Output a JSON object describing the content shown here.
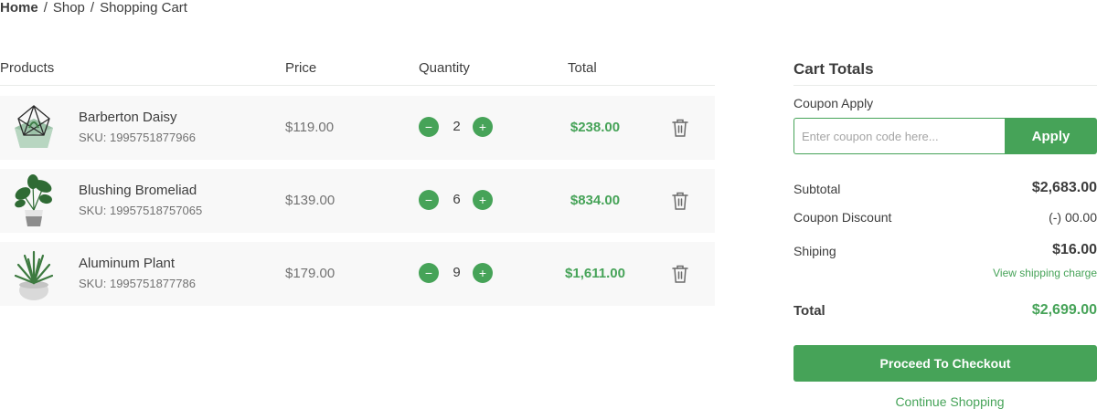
{
  "breadcrumb": {
    "home": "Home",
    "shop": "Shop",
    "current": "Shopping Cart",
    "separator": "/"
  },
  "table": {
    "headers": {
      "products": "Products",
      "price": "Price",
      "quantity": "Quantity",
      "total": "Total"
    },
    "rows": [
      {
        "name": "Barberton Daisy",
        "sku_label": "SKU:",
        "sku": "1995751877966",
        "price": "$119.00",
        "qty": "2",
        "total": "$238.00",
        "image": "geometric-terrarium-plant"
      },
      {
        "name": "Blushing Bromeliad",
        "sku_label": "SKU:",
        "sku": "19957518757065",
        "price": "$139.00",
        "qty": "6",
        "total": "$834.00",
        "image": "potted-leafy-plant"
      },
      {
        "name": "Aluminum Plant",
        "sku_label": "SKU:",
        "sku": "1995751877786",
        "price": "$179.00",
        "qty": "9",
        "total": "$1,611.00",
        "image": "potted-succulent-plant"
      }
    ],
    "minus_symbol": "−",
    "plus_symbol": "+"
  },
  "totals": {
    "title": "Cart Totals",
    "coupon_label": "Coupon Apply",
    "coupon_placeholder": "Enter coupon code here...",
    "apply_label": "Apply",
    "subtotal_label": "Subtotal",
    "subtotal_value": "$2,683.00",
    "discount_label": "Coupon Discount",
    "discount_value": "(-) 00.00",
    "shipping_label": "Shiping",
    "shipping_value": "$16.00",
    "shipping_link": "View shipping charge",
    "total_label": "Total",
    "total_value": "$2,699.00",
    "checkout_label": "Proceed To Checkout",
    "continue_label": "Continue Shopping"
  },
  "colors": {
    "accent": "#46a358",
    "text": "#3d3d3d",
    "muted": "#727272",
    "row_bg": "#f8f8f8"
  }
}
